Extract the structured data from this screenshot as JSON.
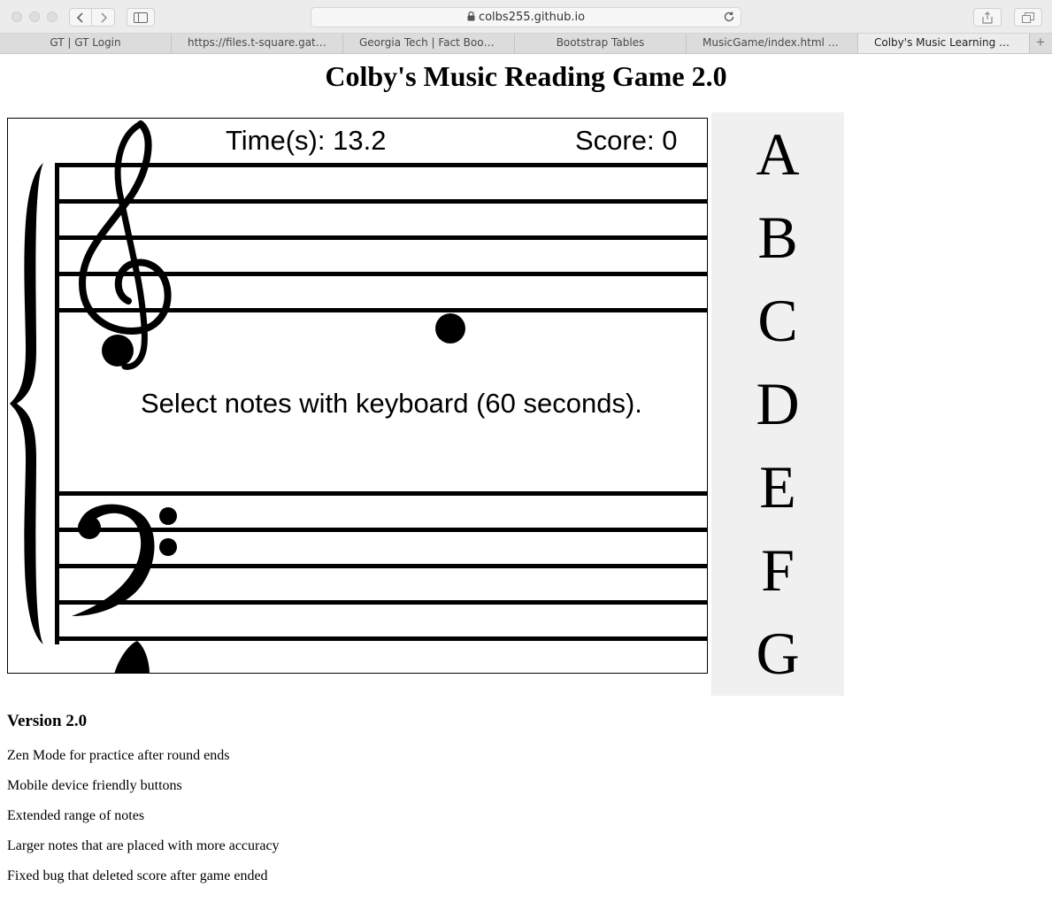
{
  "browser": {
    "url": "colbs255.github.io",
    "tabs": [
      {
        "label": "GT | GT Login"
      },
      {
        "label": "https://files.t-square.gatech..."
      },
      {
        "label": "Georgia Tech | Fact Book Cl..."
      },
      {
        "label": "Bootstrap Tables"
      },
      {
        "label": "MusicGame/index.html at m..."
      },
      {
        "label": "Colby's Music Learning Game"
      }
    ],
    "new_tab_label": "+"
  },
  "page": {
    "title": "Colby's Music Reading Game 2.0"
  },
  "game": {
    "time_text": "Time(s): 13.2",
    "score_text": "Score: 0",
    "instructions": "Select notes with keyboard (60 seconds)."
  },
  "note_buttons": [
    "A",
    "B",
    "C",
    "D",
    "E",
    "F",
    "G"
  ],
  "version": {
    "title": "Version 2.0",
    "changes": [
      "Zen Mode for practice after round ends",
      "Mobile device friendly buttons",
      "Extended range of notes",
      "Larger notes that are placed with more accuracy",
      "Fixed bug that deleted score after game ended"
    ]
  }
}
